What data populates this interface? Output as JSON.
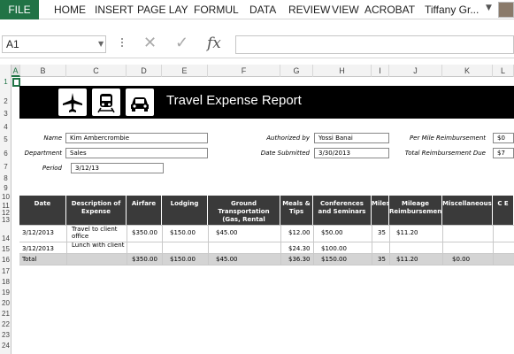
{
  "ribbon": {
    "file": "FILE",
    "tabs": [
      "HOME",
      "INSERT",
      "PAGE LAY",
      "FORMUL",
      "DATA",
      "REVIEW",
      "VIEW",
      "ACROBAT"
    ],
    "user": "Tiffany Gr..."
  },
  "formula_bar": {
    "cell_ref": "A1",
    "cancel_icon": "✕",
    "enter_icon": "✓",
    "fx": "fx",
    "formula": ""
  },
  "columns": [
    "A",
    "B",
    "C",
    "D",
    "E",
    "F",
    "G",
    "H",
    "I",
    "J",
    "K",
    "L"
  ],
  "rows": [
    "1",
    "2",
    "3",
    "4",
    "5",
    "6",
    "7",
    "8",
    "9",
    "10",
    "11",
    "12",
    "13",
    "14",
    "15",
    "16",
    "17",
    "18",
    "19",
    "20",
    "21",
    "22",
    "23",
    "24"
  ],
  "sheet": {
    "title": "Travel Expense Report",
    "icons": [
      "airplane-icon",
      "train-icon",
      "car-icon"
    ],
    "fields": {
      "name_label": "Name",
      "name_value": "Kim Ambercrombie",
      "department_label": "Department",
      "department_value": "Sales",
      "period_label": "Period",
      "period_value": "3/12/13",
      "authorized_label": "Authorized by",
      "authorized_value": "Yossi Banai",
      "submitted_label": "Date Submitted",
      "submitted_value": "3/30/2013",
      "per_mile_label": "Per Mile Reimbursement",
      "per_mile_value": "$0",
      "total_reimb_label": "Total Reimbursement Due",
      "total_reimb_value": "$7"
    },
    "table": {
      "headers": [
        "Date",
        "Description of Expense",
        "Airfare",
        "Lodging",
        "Ground Transportation (Gas, Rental",
        "Meals & Tips",
        "Conferences and Seminars",
        "Miles",
        "Mileage Reimbursement",
        "Miscellaneous",
        "C E"
      ],
      "rows": [
        [
          "3/12/2013",
          "Travel to client office",
          "$350.00",
          "$150.00",
          "$45.00",
          "$12.00",
          "$50.00",
          "35",
          "$11.20",
          "",
          ""
        ],
        [
          "3/12/2013",
          "Lunch with client",
          "",
          "",
          "",
          "$24.30",
          "$100.00",
          "",
          "",
          "",
          ""
        ]
      ],
      "total": [
        "Total",
        "",
        "$350.00",
        "$150.00",
        "$45.00",
        "$36.30",
        "$150.00",
        "35",
        "$11.20",
        "$0.00",
        ""
      ]
    }
  },
  "colors": {
    "excel_green": "#217346",
    "header_dark": "#3a3a3a",
    "title_band": "#000000",
    "total_band": "#d4d4d4"
  }
}
